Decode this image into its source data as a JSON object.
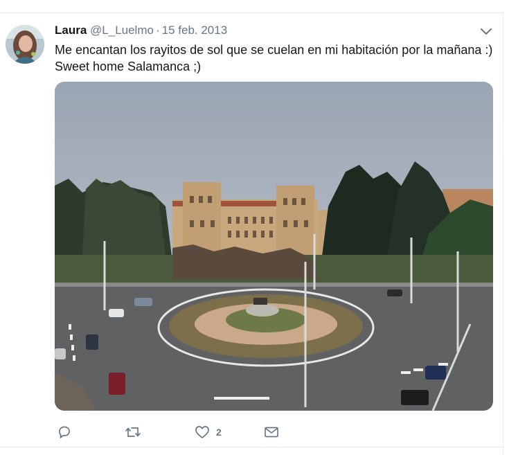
{
  "tweet": {
    "author_name": "Laura",
    "author_handle": "@L_Luelmo",
    "separator": "·",
    "date": "15 feb. 2013",
    "text_line1": "Me encantan los rayitos de sol que se cuelan en mi habitación por la mañana :)",
    "text_line2": "Sweet home Salamanca ;)",
    "avatar_icon": "avatar-photo",
    "menu_icon": "chevron-down-icon",
    "photo_subject": "roundabout-plaza-photo"
  },
  "actions": {
    "reply_icon": "reply-icon",
    "retweet_icon": "retweet-icon",
    "like_icon": "heart-icon",
    "like_count": "2",
    "dm_icon": "envelope-icon"
  },
  "colors": {
    "text_primary": "#14171a",
    "text_secondary": "#657786",
    "divider": "#e6ecf0"
  }
}
